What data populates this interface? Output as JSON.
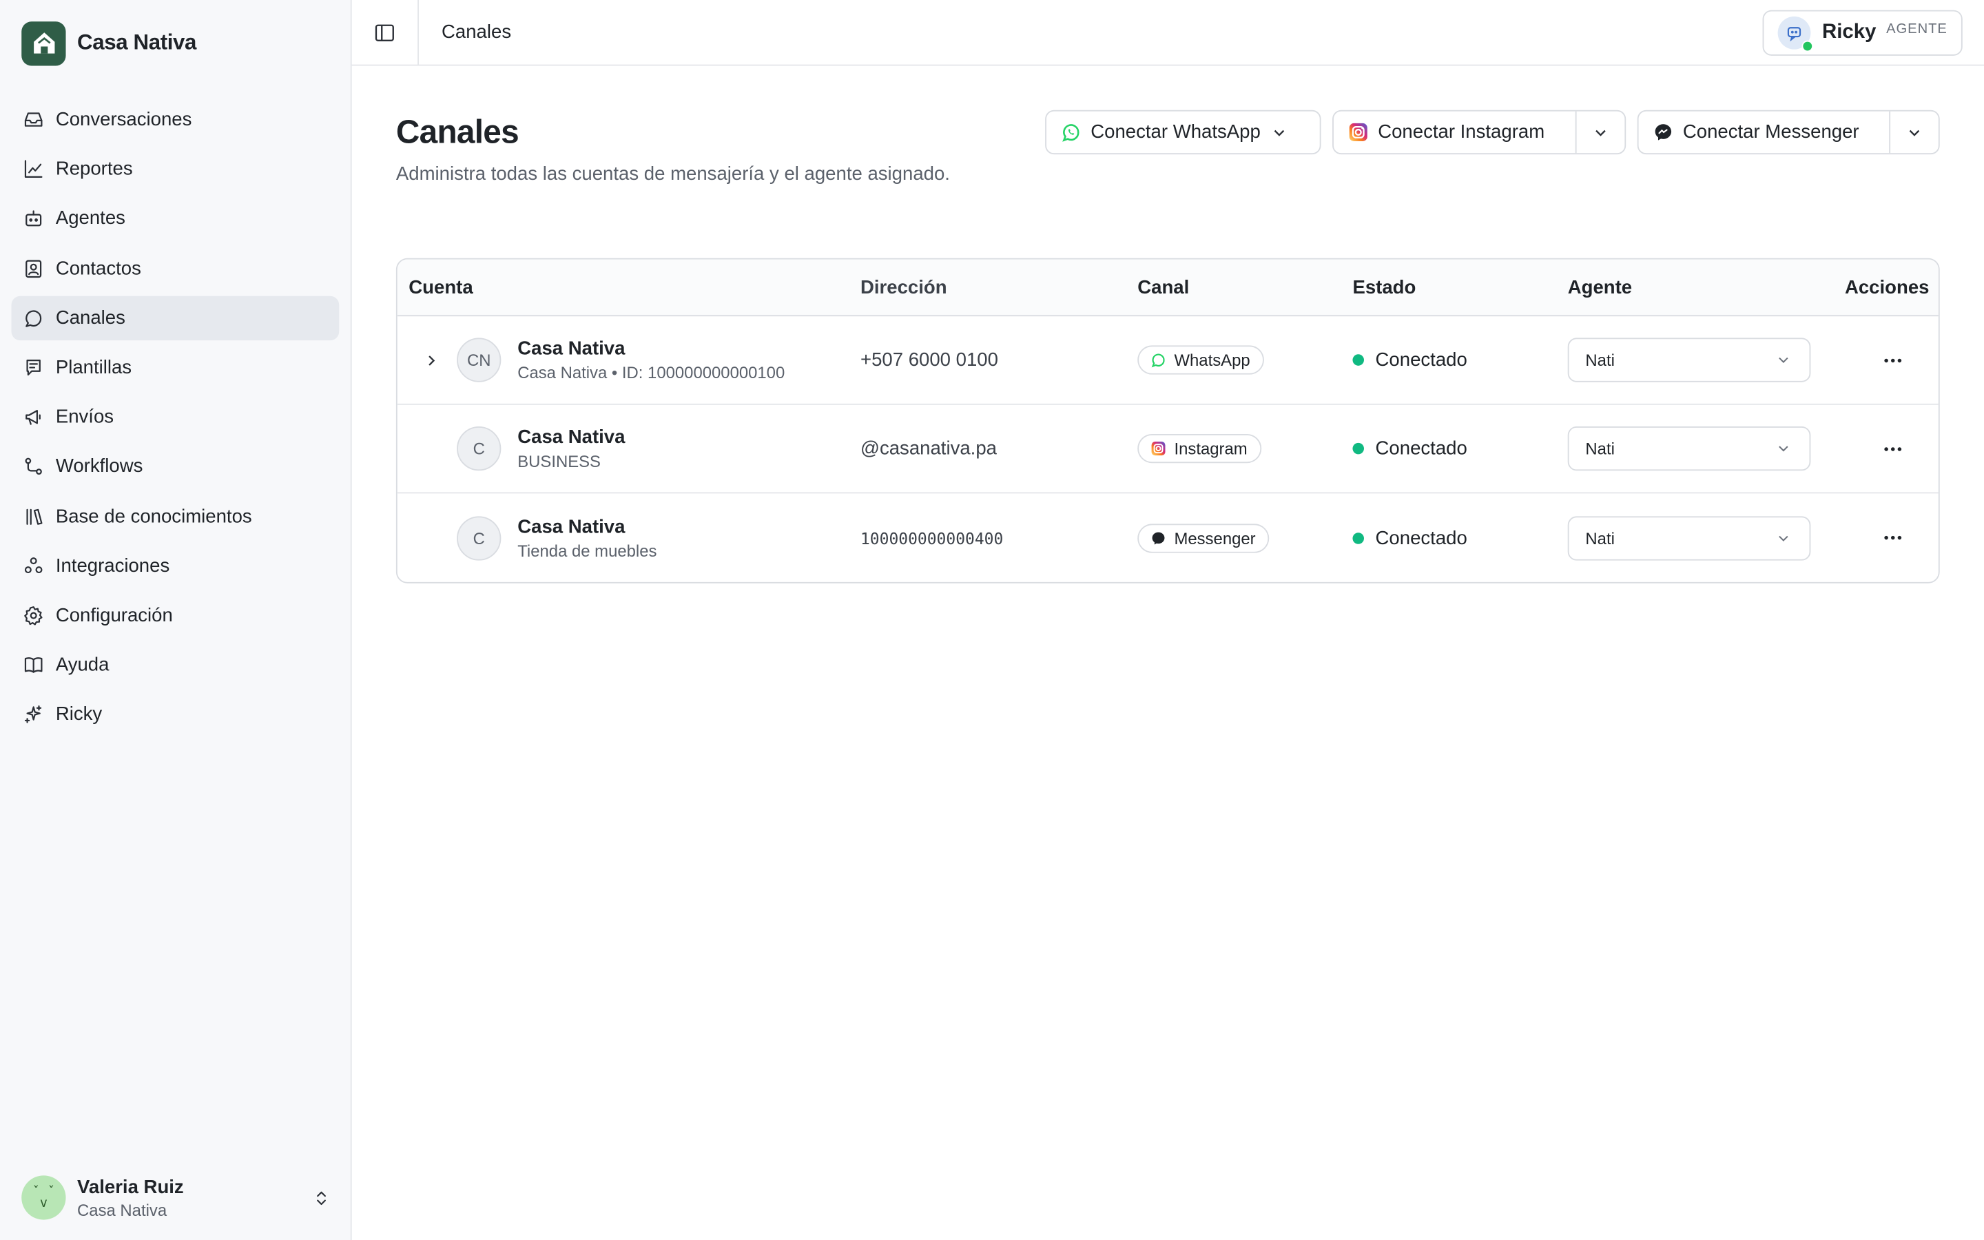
{
  "brand": {
    "name": "Casa Nativa",
    "logo_icon": "house-icon"
  },
  "sidebar": {
    "items": [
      {
        "label": "Conversaciones",
        "icon": "inbox-icon",
        "active": false
      },
      {
        "label": "Reportes",
        "icon": "chart-icon",
        "active": false
      },
      {
        "label": "Agentes",
        "icon": "bot-icon",
        "active": false
      },
      {
        "label": "Contactos",
        "icon": "contact-icon",
        "active": false
      },
      {
        "label": "Canales",
        "icon": "chat-bubble-icon",
        "active": true
      },
      {
        "label": "Plantillas",
        "icon": "template-icon",
        "active": false
      },
      {
        "label": "Envíos",
        "icon": "megaphone-icon",
        "active": false
      },
      {
        "label": "Workflows",
        "icon": "workflow-icon",
        "active": false
      },
      {
        "label": "Base de conocimientos",
        "icon": "library-icon",
        "active": false
      },
      {
        "label": "Integraciones",
        "icon": "integrations-icon",
        "active": false
      },
      {
        "label": "Configuración",
        "icon": "gear-icon",
        "active": false
      },
      {
        "label": "Ayuda",
        "icon": "book-icon",
        "active": false
      },
      {
        "label": "Ricky",
        "icon": "sparkles-icon",
        "active": false
      }
    ]
  },
  "user": {
    "name": "Valeria Ruiz",
    "org": "Casa Nativa"
  },
  "topbar": {
    "breadcrumb": "Canales",
    "agent_name": "Ricky",
    "agent_role": "AGENTE"
  },
  "page": {
    "title": "Canales",
    "subtitle": "Administra todas las cuentas de mensajería y el agente asignado.",
    "buttons": {
      "whatsapp": "Conectar WhatsApp",
      "instagram": "Conectar Instagram",
      "messenger": "Conectar Messenger"
    }
  },
  "table": {
    "headers": {
      "cuenta": "Cuenta",
      "direccion": "Dirección",
      "canal": "Canal",
      "estado": "Estado",
      "agente": "Agente",
      "acciones": "Acciones"
    },
    "rows": [
      {
        "avatar": "CN",
        "name": "Casa Nativa",
        "sub": "Casa Nativa • ID: 100000000000100",
        "direccion": "+507 6000 0100",
        "canal": "WhatsApp",
        "estado": "Conectado",
        "agente": "Nati"
      },
      {
        "avatar": "C",
        "name": "Casa Nativa",
        "sub": "BUSINESS",
        "direccion": "@casanativa.pa",
        "canal": "Instagram",
        "estado": "Conectado",
        "agente": "Nati"
      },
      {
        "avatar": "C",
        "name": "Casa Nativa",
        "sub": "Tienda de muebles",
        "direccion": "100000000000400",
        "canal": "Messenger",
        "estado": "Conectado",
        "agente": "Nati"
      }
    ]
  },
  "colors": {
    "brand": "#2f5d47",
    "active_nav": "#e6e9ee",
    "status_connected": "#10b981",
    "whatsapp": "#25d366",
    "instagram": "#d62976"
  }
}
